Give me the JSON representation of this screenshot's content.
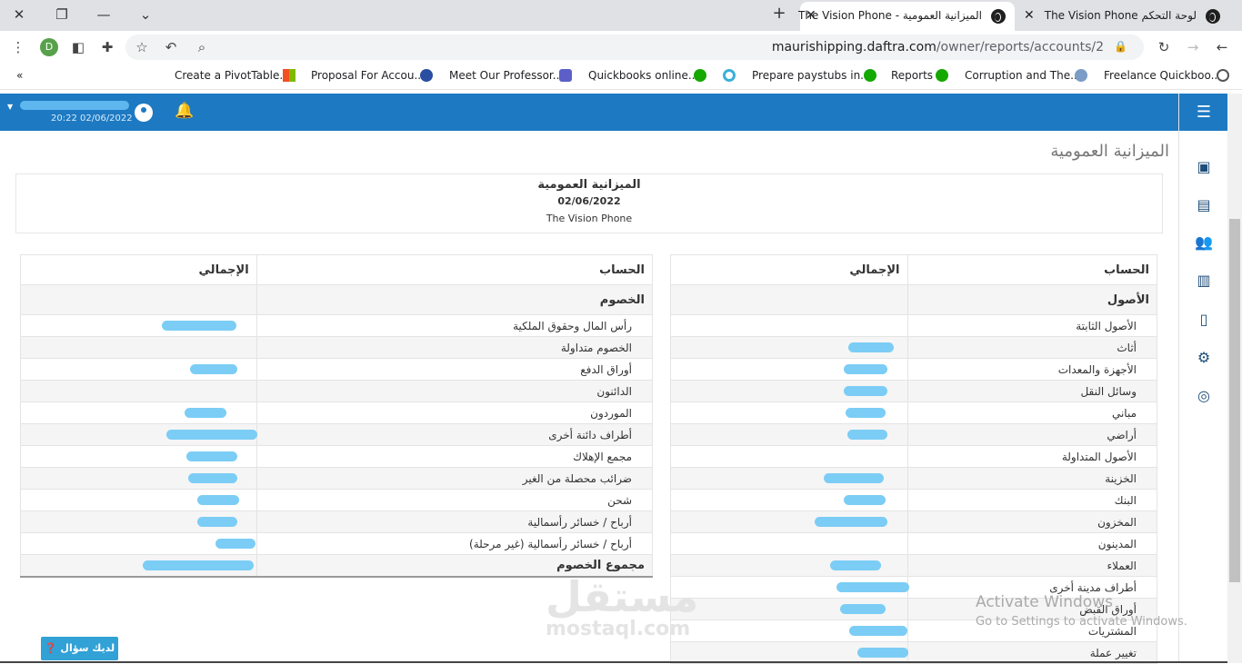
{
  "browser": {
    "tabs": [
      {
        "title": "The Vision Phone - الميزانية العمومية",
        "active": true
      },
      {
        "title": "The Vision Phone لوحة التحكم",
        "active": false
      }
    ],
    "url_host": "maurishipping.daftra.com",
    "url_path": "/owner/reports/accounts/2",
    "profile_initial": "D",
    "bookmarks": [
      "Create a PivotTable...",
      "Proposal For Accou...",
      "Meet Our Professor...",
      "Quickbooks online...",
      "Prepare paystubs in...",
      "Reports",
      "Corruption and The...",
      "Freelance Quickboo..."
    ]
  },
  "header": {
    "datetime": "20:22 02/06/2022"
  },
  "page": {
    "title": "الميزانية العمومية",
    "report_title": "الميزانية العمومية",
    "report_date": "02/06/2022",
    "company": "The Vision Phone"
  },
  "assets": {
    "col_account": "الحساب",
    "col_total": "الإجمالي",
    "rows": [
      {
        "label": "الأصول",
        "kind": "section"
      },
      {
        "label": "الأصول الثابتة",
        "kind": "group"
      },
      {
        "label": "أثاث",
        "kind": "item"
      },
      {
        "label": "الأجهزة والمعدات",
        "kind": "item"
      },
      {
        "label": "وسائل النقل",
        "kind": "item"
      },
      {
        "label": "مباني",
        "kind": "item"
      },
      {
        "label": "أراضي",
        "kind": "item"
      },
      {
        "label": "الأصول المتداولة",
        "kind": "group"
      },
      {
        "label": "الخزينة",
        "kind": "item"
      },
      {
        "label": "البنك",
        "kind": "item"
      },
      {
        "label": "المخزون",
        "kind": "item"
      },
      {
        "label": "المدينون",
        "kind": "group"
      },
      {
        "label": "العملاء",
        "kind": "item"
      },
      {
        "label": "أطراف مدينة أخرى",
        "kind": "item"
      },
      {
        "label": "أوراق القبض",
        "kind": "item"
      },
      {
        "label": "المشتريات",
        "kind": "item"
      },
      {
        "label": "تغيير عملة",
        "kind": "item"
      }
    ]
  },
  "liabilities": {
    "col_account": "الحساب",
    "col_total": "الإجمالي",
    "rows": [
      {
        "label": "الخصوم",
        "kind": "section"
      },
      {
        "label": "رأس المال وحقوق الملكية",
        "kind": "item"
      },
      {
        "label": "الخصوم متداولة",
        "kind": "group"
      },
      {
        "label": "أوراق الدفع",
        "kind": "item"
      },
      {
        "label": "الدائنون",
        "kind": "group"
      },
      {
        "label": "الموردون",
        "kind": "item"
      },
      {
        "label": "أطراف دائنة أخرى",
        "kind": "item"
      },
      {
        "label": "مجمع الإهلاك",
        "kind": "item"
      },
      {
        "label": "ضرائب محصلة من الغير",
        "kind": "item"
      },
      {
        "label": "شحن",
        "kind": "item"
      },
      {
        "label": "أرباح / خسائر رأسمالية",
        "kind": "item"
      },
      {
        "label": "أرباح / خسائر رأسمالية (غير مرحلة)",
        "kind": "group"
      },
      {
        "label": "مجموع الخصوم",
        "kind": "total"
      }
    ]
  },
  "help_button": "لديك سؤال",
  "overlay": {
    "activate_title": "Activate Windows",
    "activate_sub": "Go to Settings to activate Windows.",
    "watermark_ar": "مستقل",
    "watermark_en": "mostaql.com"
  },
  "colors": {
    "header_blue": "#1d7ac2",
    "redaction_blue": "#7bcdf5"
  }
}
